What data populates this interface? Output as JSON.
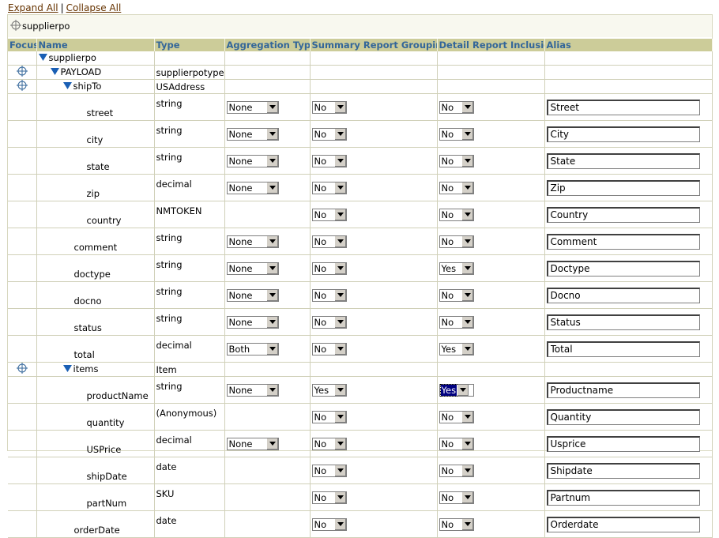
{
  "links": {
    "expand_all": "Expand All",
    "separator": "|",
    "collapse_all": "Collapse All"
  },
  "breadcrumb": {
    "label": "supplierpo"
  },
  "columns": {
    "focus": "Focus",
    "name": "Name",
    "type": "Type",
    "aggregation": "Aggregation Type",
    "summary": "Summary Report Grouping",
    "detail": "Detail Report Inclusion",
    "alias": "Alias"
  },
  "rows": [
    {
      "indent": 0,
      "expand": true,
      "focus": false,
      "name": "supplierpo",
      "type": ""
    },
    {
      "indent": 1,
      "expand": true,
      "focus": true,
      "name": "PAYLOAD",
      "type": "supplierpotype"
    },
    {
      "indent": 2,
      "expand": true,
      "focus": true,
      "name": "shipTo",
      "type": "USAddress"
    },
    {
      "indent": 3,
      "name": "street",
      "type": "string",
      "aggregation": "None",
      "summary": "No",
      "detail": "No",
      "alias": "Street"
    },
    {
      "indent": 3,
      "name": "city",
      "type": "string",
      "aggregation": "None",
      "summary": "No",
      "detail": "No",
      "alias": "City"
    },
    {
      "indent": 3,
      "name": "state",
      "type": "string",
      "aggregation": "None",
      "summary": "No",
      "detail": "No",
      "alias": "State"
    },
    {
      "indent": 3,
      "name": "zip",
      "type": "decimal",
      "aggregation": "None",
      "summary": "No",
      "detail": "No",
      "alias": "Zip"
    },
    {
      "indent": 3,
      "name": "country",
      "type": "NMTOKEN",
      "summary": "No",
      "detail": "No",
      "alias": "Country"
    },
    {
      "indent": 2,
      "name": "comment",
      "type": "string",
      "aggregation": "None",
      "summary": "No",
      "detail": "No",
      "alias": "Comment"
    },
    {
      "indent": 2,
      "name": "doctype",
      "type": "string",
      "aggregation": "None",
      "summary": "No",
      "detail": "Yes",
      "alias": "Doctype"
    },
    {
      "indent": 2,
      "name": "docno",
      "type": "string",
      "aggregation": "None",
      "summary": "No",
      "detail": "No",
      "alias": "Docno"
    },
    {
      "indent": 2,
      "name": "status",
      "type": "string",
      "aggregation": "None",
      "summary": "No",
      "detail": "No",
      "alias": "Status"
    },
    {
      "indent": 2,
      "name": "total",
      "type": "decimal",
      "aggregation": "Both",
      "summary": "No",
      "detail": "Yes",
      "alias": "Total"
    },
    {
      "indent": 2,
      "expand": true,
      "focus": true,
      "name": "items",
      "type": "Item"
    },
    {
      "indent": 3,
      "name": "productName",
      "type": "string",
      "aggregation": "None",
      "summary": "Yes",
      "detail": "Yes",
      "detail_focused": true,
      "alias": "Productname"
    },
    {
      "indent": 3,
      "name": "quantity",
      "type": "(Anonymous)",
      "summary": "No",
      "detail": "No",
      "alias": "Quantity"
    },
    {
      "indent": 3,
      "name": "USPrice",
      "type": "decimal",
      "aggregation": "None",
      "summary": "No",
      "detail": "No",
      "alias": "Usprice"
    },
    {
      "indent": 3,
      "name": "shipDate",
      "type": "date",
      "summary": "No",
      "detail": "No",
      "alias": "Shipdate"
    },
    {
      "indent": 3,
      "name": "partNum",
      "type": "SKU",
      "summary": "No",
      "detail": "No",
      "alias": "Partnum"
    },
    {
      "indent": 2,
      "name": "orderDate",
      "type": "date",
      "summary": "No",
      "detail": "No",
      "alias": "Orderdate"
    }
  ]
}
